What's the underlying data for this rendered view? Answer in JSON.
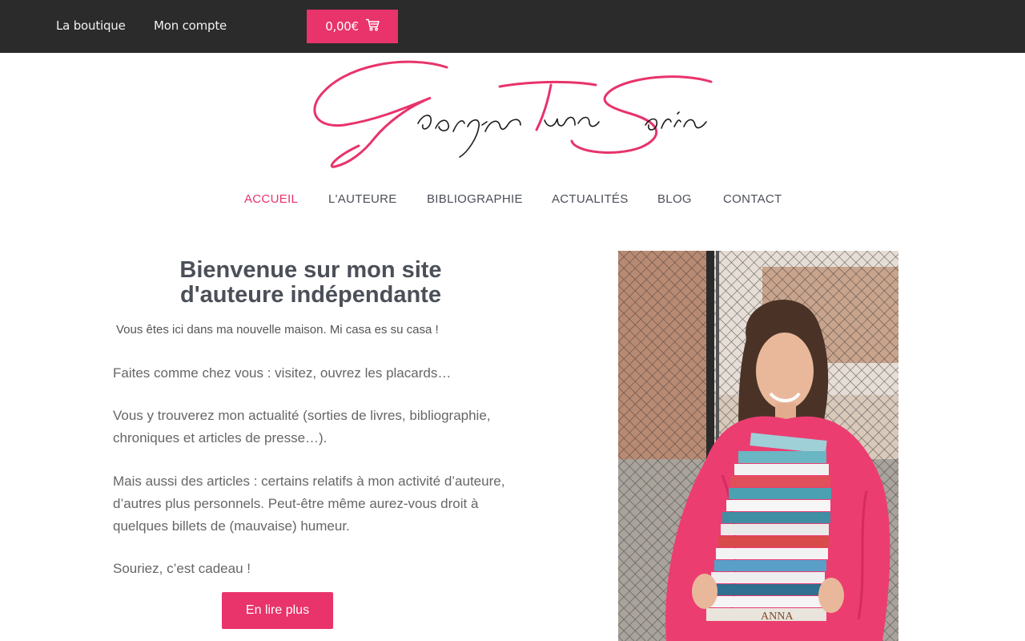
{
  "topbar": {
    "links": [
      "La boutique",
      "Mon compte"
    ],
    "cart_label": "0,00€",
    "cart_icon": "shopping-cart-icon",
    "background": "#2b2b2b",
    "accent": "#e8336b"
  },
  "logo": {
    "text": "Georgina Tuna Sorin"
  },
  "nav": {
    "items": [
      "ACCUEIL",
      "L'AUTEURE",
      "BIBLIOGRAPHIE",
      "ACTUALITÉS",
      "BLOG",
      "CONTACT"
    ],
    "active": "ACCUEIL"
  },
  "content": {
    "title_line1": "Bienvenue sur mon site",
    "title_line2": "d'auteure indépendante",
    "intro": "Vous êtes ici dans ma nouvelle maison. Mi casa es su casa !",
    "p1": "Faites comme chez vous : visitez, ouvrez les placards…",
    "p2": "Vous y trouverez mon actualité (sorties de livres, bibliographie, chroniques et articles de presse…).",
    "p3": "Mais aussi des articles : certains relatifs à mon activité d’auteure, d’autres plus personnels. Peut-être même aurez-vous droit à quelques billets de (mauvaise) humeur.",
    "p4": "Souriez, c’est cadeau !",
    "read_more": "En lire plus"
  },
  "photo": {
    "book_label": "ANNA"
  }
}
